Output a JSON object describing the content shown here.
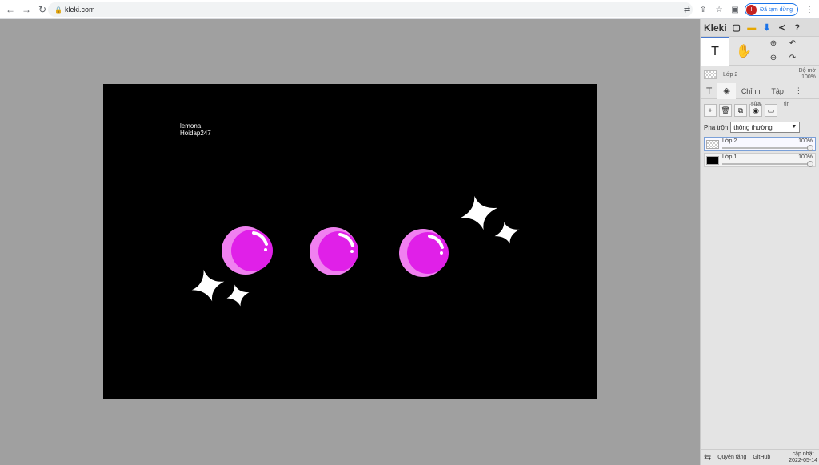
{
  "browser": {
    "url": "kleki.com",
    "profile_initial": "I",
    "profile_status": "Đã tạm dừng"
  },
  "canvas": {
    "background": "#000000",
    "text_lines": [
      "lemona",
      "Hoidap247"
    ],
    "bubble_color": "#e020e8",
    "bubble_light": "#f080f0",
    "sparkle_color": "#ffffff"
  },
  "app": {
    "name": "Kleki"
  },
  "layer_preview": {
    "name": "Lớp 2",
    "opacity_label": "Độ mờ",
    "opacity_value": "100%"
  },
  "tabs": [
    {
      "label": "T"
    },
    {
      "label": "layers-icon"
    },
    {
      "label": "Chỉnh"
    },
    {
      "label": "Tập"
    }
  ],
  "layer_tools": {
    "edit_label": "sửa",
    "info_label": "tin"
  },
  "blend": {
    "label": "Pha trộn",
    "value": "thông thường"
  },
  "layers": [
    {
      "name": "Lớp 2",
      "opacity": "100%",
      "selected": true
    },
    {
      "name": "Lớp 1",
      "opacity": "100%",
      "selected": false
    }
  ],
  "footer": {
    "ads_label": "Quyên tặng",
    "github_label": "GitHub",
    "update_label": "cập nhật",
    "update_date": "2022-05-14"
  }
}
